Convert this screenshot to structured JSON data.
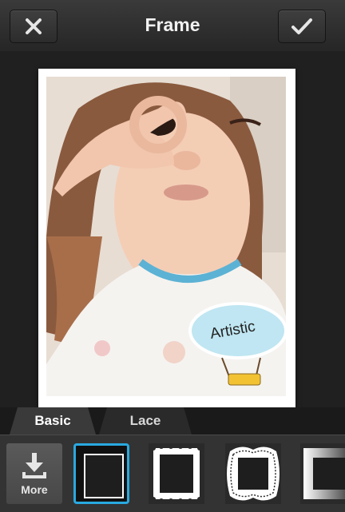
{
  "header": {
    "title": "Frame",
    "close_icon": "close-x-icon",
    "confirm_icon": "checkmark-icon"
  },
  "photo": {
    "sticker_text": "Artistic"
  },
  "tabs": [
    {
      "label": "Basic",
      "selected": true
    },
    {
      "label": "Lace",
      "selected": false
    }
  ],
  "frames_strip": {
    "more_label": "More",
    "more_icon": "download-icon",
    "options": [
      {
        "name": "plain-square",
        "selected": true
      },
      {
        "name": "scalloped",
        "selected": false
      },
      {
        "name": "lace",
        "selected": false
      },
      {
        "name": "soft-edge",
        "selected": false
      }
    ]
  },
  "colors": {
    "accent": "#29a9e0",
    "background": "#1c1c1c"
  }
}
